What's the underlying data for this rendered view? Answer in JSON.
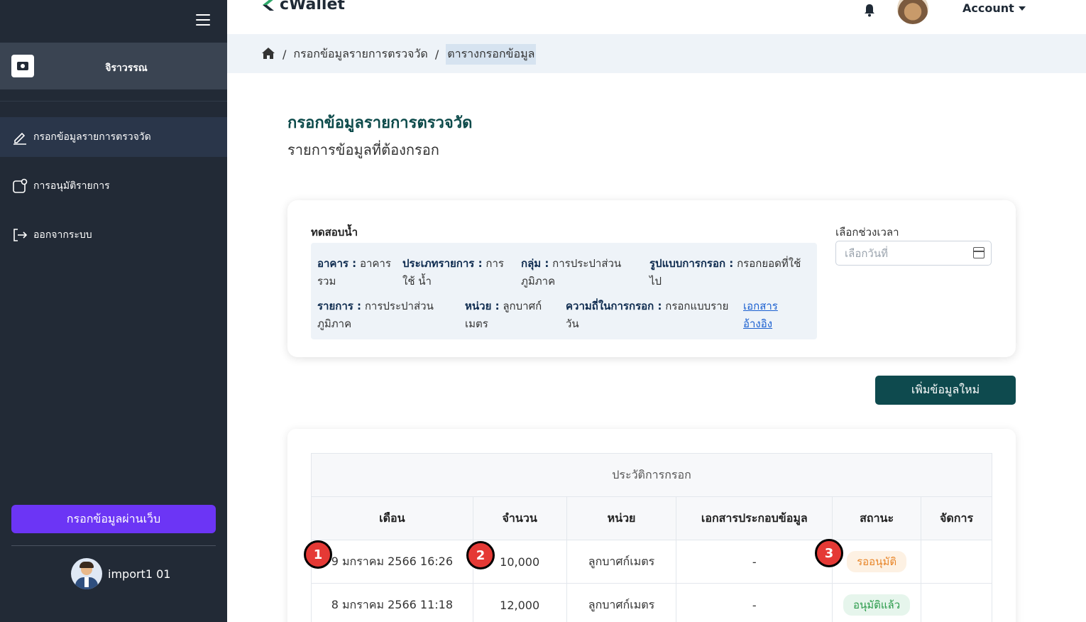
{
  "sidebar": {
    "profile_name": "จิราวรรณ",
    "items": [
      {
        "label": "กรอกข้อมูลรายการตรวจวัด",
        "icon": "pencil-icon"
      },
      {
        "label": "การอนุมัติรายการ",
        "icon": "approval-icon"
      },
      {
        "label": "ออกจากระบบ",
        "icon": "logout-icon"
      }
    ],
    "web_button": "กรอกข้อมูลผ่านเว็บ",
    "user_name": "import1 01"
  },
  "topbar": {
    "logo_text": "cWallet",
    "account_label": "Account"
  },
  "breadcrumb": {
    "parent": "กรอกข้อมูลรายการตรวจวัด",
    "current": "ตารางกรอกข้อมูล",
    "separator": "/"
  },
  "page": {
    "title": "กรอกข้อมูลรายการตรวจวัด",
    "subtitle": "รายการข้อมูลที่ต้องกรอก"
  },
  "info": {
    "title": "ทดสอบน้ำ",
    "building_label": "อาคาร :",
    "building_value": "อาคาร รวม",
    "type_label": "ประเภทรายการ :",
    "type_value": "การใช้ น้ำ",
    "group_label": "กลุ่ม :",
    "group_value": "การประปาส่วน ภูมิภาค",
    "format_label": "รูปแบบการกรอก :",
    "format_value": "กรอกยอดที่ใช้ ไป",
    "item_label": "รายการ :",
    "item_value": "การประปาส่วน ภูมิภาค",
    "unit_label": "หน่วย :",
    "unit_value": "ลูกบาศก์ เมตร",
    "freq_label": "ความถี่ในการกรอก :",
    "freq_value": "กรอกแบบราย วัน",
    "ref_link": "เอกสาร อ้างอิง",
    "period_label": "เลือกช่วงเวลา",
    "date_placeholder": "เลือกวันที่"
  },
  "add_button": "เพิ่มข้อมูลใหม่",
  "table": {
    "caption": "ประวัติการกรอก",
    "headers": [
      "เดือน",
      "จำนวน",
      "หน่วย",
      "เอกสารประกอบข้อมูล",
      "สถานะ",
      "จัดการ"
    ],
    "rows": [
      {
        "month": "9 มกราคม 2566 16:26",
        "amount": "10,000",
        "unit": "ลูกบาศก์เมตร",
        "doc": "-",
        "status": "รออนุมัติ",
        "status_color": "#e8862a"
      },
      {
        "month": "8 มกราคม 2566 11:18",
        "amount": "12,000",
        "unit": "ลูกบาศก์เมตร",
        "doc": "-",
        "status": "อนุมัติแล้ว",
        "status_color": "#2a9a4a"
      }
    ]
  },
  "markers": [
    "1",
    "2",
    "3"
  ],
  "colors": {
    "sidebar_bg": "#222a36",
    "accent_purple": "#6c35f5",
    "primary_teal": "#0e4a4e",
    "title_color": "#0c4a4a"
  }
}
